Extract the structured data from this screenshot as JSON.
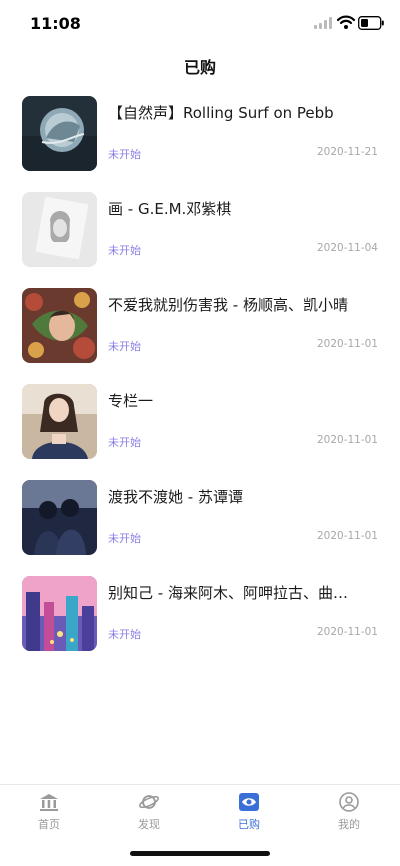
{
  "status_bar": {
    "time": "11:08"
  },
  "nav": {
    "title": "已购"
  },
  "items": [
    {
      "title": "【自然声】Rolling Surf on Pebb",
      "status": "未开始",
      "date": "2020-11-21",
      "thumb": "ocean-cover"
    },
    {
      "title": "画 - G.E.M.邓紫棋",
      "status": "未开始",
      "date": "2020-11-04",
      "thumb": "sketch-cover"
    },
    {
      "title": "不爱我就别伤害我 - 杨顺高、凯小晴",
      "status": "未开始",
      "date": "2020-11-01",
      "thumb": "floral-cover"
    },
    {
      "title": "专栏一",
      "status": "未开始",
      "date": "2020-11-01",
      "thumb": "portrait-cover"
    },
    {
      "title": "渡我不渡她 - 苏谭谭",
      "status": "未开始",
      "date": "2020-11-01",
      "thumb": "couple-cover"
    },
    {
      "title": "别知己 - 海来阿木、阿呷拉古、曲…",
      "status": "未开始",
      "date": "2020-11-01",
      "thumb": "city-cover"
    }
  ],
  "tabs": [
    {
      "label": "首页",
      "icon": "bank-icon",
      "active": false
    },
    {
      "label": "发现",
      "icon": "planet-icon",
      "active": false
    },
    {
      "label": "已购",
      "icon": "purchased-icon",
      "active": true
    },
    {
      "label": "我的",
      "icon": "user-icon",
      "active": false
    }
  ],
  "colors": {
    "status": "#8b80e8",
    "active_tab": "#3a6fd8",
    "inactive_tab": "#9a9a9a"
  }
}
